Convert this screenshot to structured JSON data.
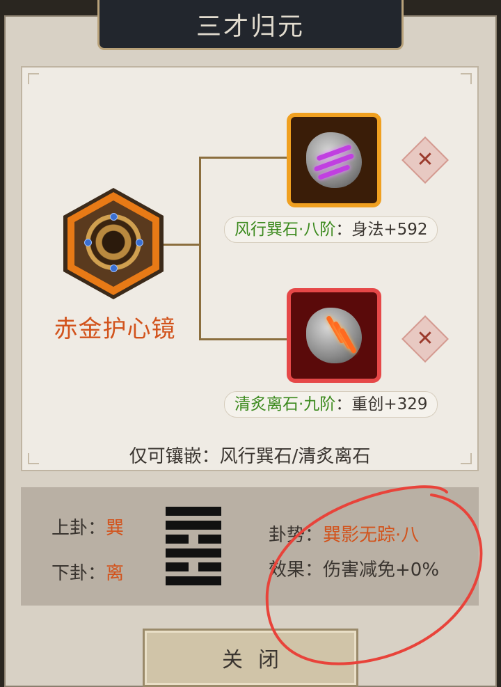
{
  "title": "三才归元",
  "equipment": {
    "name": "赤金护心镜"
  },
  "slots": [
    {
      "stone_name": "风行巽石·八阶",
      "separator": "：",
      "stat": "身法+592",
      "remove_symbol": "✕"
    },
    {
      "stone_name": "清炙离石·九阶",
      "separator": "：",
      "stat": "重创+329",
      "remove_symbol": "✕"
    }
  ],
  "hint": "仅可镶嵌：风行巽石/清炙离石",
  "gua": {
    "upper_label": "上卦：",
    "upper_value": "巽",
    "lower_label": "下卦：",
    "lower_value": "离",
    "trend_label": "卦势：",
    "trend_value": "巽影无踪·八",
    "effect_label": "效果：",
    "effect_value": "伤害减免+0%"
  },
  "close_label": "关闭",
  "colors": {
    "accent_orange": "#d2531c",
    "stone_green": "#3c8a1e",
    "annotation_red": "#e8433a"
  },
  "icons": [
    "mirror-icon",
    "purple-stone-icon",
    "red-stone-icon",
    "remove-icon",
    "hexagram-icon"
  ]
}
